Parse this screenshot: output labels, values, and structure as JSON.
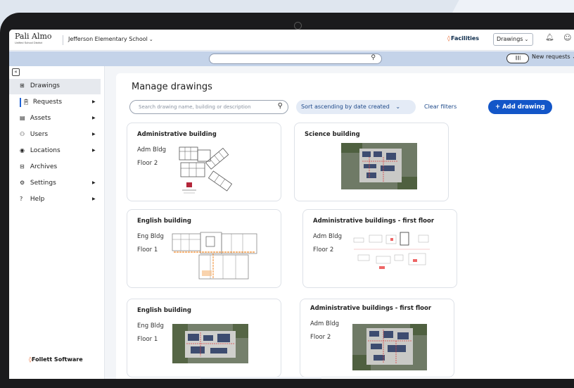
{
  "header": {
    "logo": "Pali Almo",
    "logo_sub": "Unified School District",
    "school": "Jefferson Elementary School",
    "app": "Facilities",
    "module": "Drawings"
  },
  "toolbar": {
    "barcode": "|||||",
    "new_requests": "New requests"
  },
  "sidebar": {
    "items": [
      {
        "label": "Drawings",
        "icon": "grid-icon"
      },
      {
        "label": "Requests",
        "icon": "clipboard-icon"
      },
      {
        "label": "Assets",
        "icon": "cabinet-icon"
      },
      {
        "label": "Users",
        "icon": "users-icon"
      },
      {
        "label": "Locations",
        "icon": "location-pin-icon"
      },
      {
        "label": "Archives",
        "icon": "archive-icon"
      },
      {
        "label": "Settings",
        "icon": "gear-icon"
      },
      {
        "label": "Help",
        "icon": "help-icon"
      }
    ],
    "footer": "Follett Software"
  },
  "main": {
    "title": "Manage drawings",
    "search_placeholder": "Search drawing name, building or description",
    "sort_label": "Sort ascending by date created",
    "clear_filters": "Clear filters",
    "add_button": "+ Add drawing"
  },
  "cards": [
    {
      "title": "Administrative building",
      "code": "Adm Bldg",
      "floor": "Floor 2",
      "thumb": "floorplan-line-icon"
    },
    {
      "title": "Science building",
      "code": "",
      "floor": "",
      "thumb": "aerial-photo-icon"
    },
    {
      "title": "English building",
      "code": "Eng Bldg",
      "floor": "Floor 1",
      "thumb": "floorplan-color-icon"
    },
    {
      "title": "Administrative buildings - first floor",
      "code": "Adm Bldg",
      "floor": "Floor 2",
      "thumb": "floorplan-sparse-icon"
    },
    {
      "title": "English building",
      "code": "Eng Bldg",
      "floor": "Floor 1",
      "thumb": "aerial-photo-icon"
    },
    {
      "title": "Administrative buildings - first floor",
      "code": "Adm Bldg",
      "floor": "Floor 2",
      "thumb": "aerial-photo-icon"
    }
  ],
  "colors": {
    "primary": "#1356c8",
    "accent": "#e85d1e",
    "toolbar_bg": "#c4d3e9"
  }
}
